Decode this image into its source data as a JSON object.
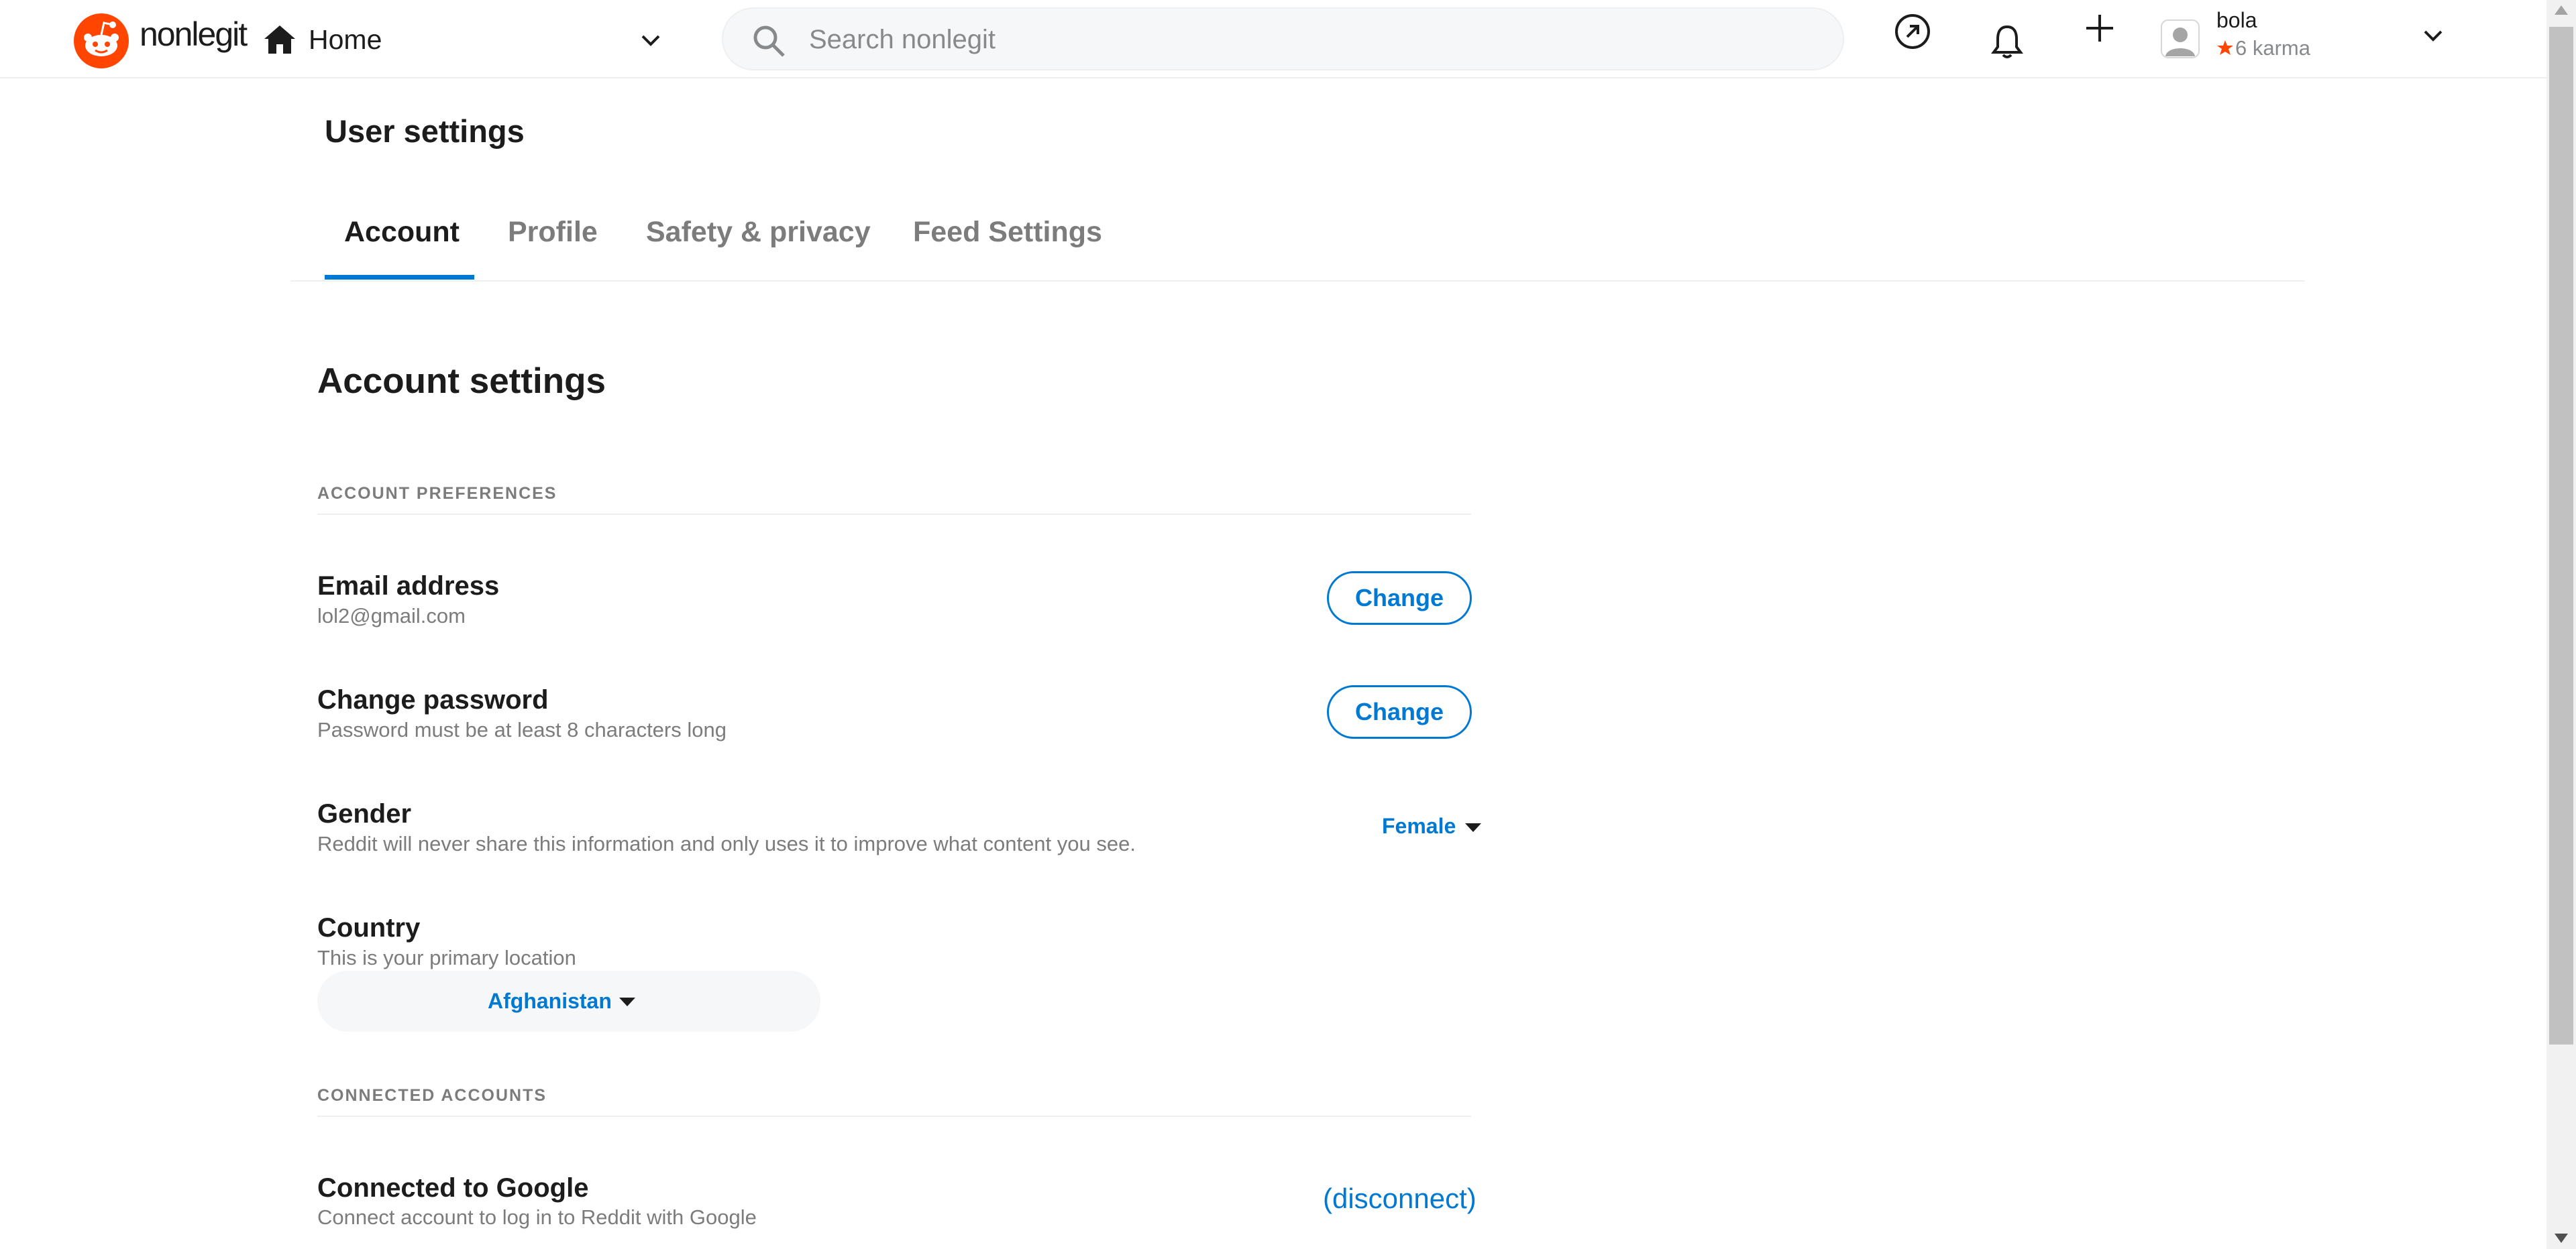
{
  "header": {
    "brand": "nonlegit",
    "home_label": "Home",
    "search_placeholder": "Search nonlegit",
    "user": {
      "name": "bola",
      "karma": "6 karma"
    }
  },
  "page": {
    "title": "User settings",
    "tabs": [
      {
        "label": "Account",
        "active": true
      },
      {
        "label": "Profile",
        "active": false
      },
      {
        "label": "Safety & privacy",
        "active": false
      },
      {
        "label": "Feed Settings",
        "active": false
      }
    ]
  },
  "account": {
    "section_title": "Account settings",
    "preferences_label": "ACCOUNT PREFERENCES",
    "email": {
      "title": "Email address",
      "value": "lol2@gmail.com",
      "button": "Change"
    },
    "password": {
      "title": "Change password",
      "desc": "Password must be at least 8 characters long",
      "button": "Change"
    },
    "gender": {
      "title": "Gender",
      "desc": "Reddit will never share this information and only uses it to improve what content you see.",
      "value": "Female"
    },
    "country": {
      "title": "Country",
      "desc": "This is your primary location",
      "value": "Afghanistan"
    },
    "connected_label": "CONNECTED ACCOUNTS",
    "google": {
      "title": "Connected to Google",
      "desc": "Connect account to log in to Reddit with Google",
      "action": "(disconnect)"
    }
  },
  "colors": {
    "accent": "#0079d3",
    "brand": "#ff4500",
    "muted": "#7c7c7c"
  },
  "icons": [
    "reddit-logo-icon",
    "home-icon",
    "chevron-down-icon",
    "search-icon",
    "popular-icon",
    "bell-icon",
    "plus-icon",
    "avatar-icon",
    "karma-icon"
  ]
}
